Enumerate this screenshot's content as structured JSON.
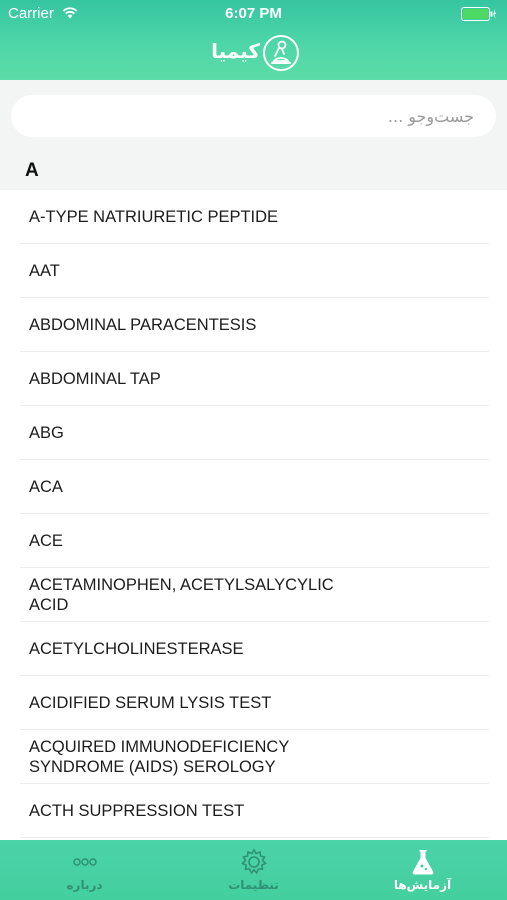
{
  "status_bar": {
    "carrier": "Carrier",
    "time": "6:07 PM"
  },
  "header": {
    "title": "کیمیا"
  },
  "search": {
    "placeholder": "جست‌وجو ..."
  },
  "section": {
    "letter": "A"
  },
  "tests": [
    "A-TYPE NATRIURETIC PEPTIDE",
    "AAT",
    "ABDOMINAL PARACENTESIS",
    "ABDOMINAL TAP",
    "ABG",
    "ACA",
    "ACE",
    "ACETAMINOPHEN, ACETYLSALYCYLIC ACID",
    "ACETYLCHOLINESTERASE",
    "ACIDIFIED SERUM LYSIS TEST",
    "ACQUIRED IMMUNODEFICIENCY SYNDROME (AIDS) SEROLOGY",
    "ACTH SUPPRESSION TEST"
  ],
  "tabbar": {
    "about_label": "درباره",
    "settings_label": "تنظیمات",
    "tests_label": "آزمایش‌ها"
  },
  "icons": {
    "wifi": "wifi-icon",
    "battery": "battery-icon",
    "logo": "microscope-logo-icon",
    "about": "ellipsis-icon",
    "settings": "gear-icon",
    "tests": "flask-icon"
  },
  "colors": {
    "accent": "#4ed6a8",
    "tab_inactive": "#2f9173",
    "tab_active": "#ffffff",
    "list_background": "#ffffff",
    "search_background": "#f3f4f4"
  }
}
